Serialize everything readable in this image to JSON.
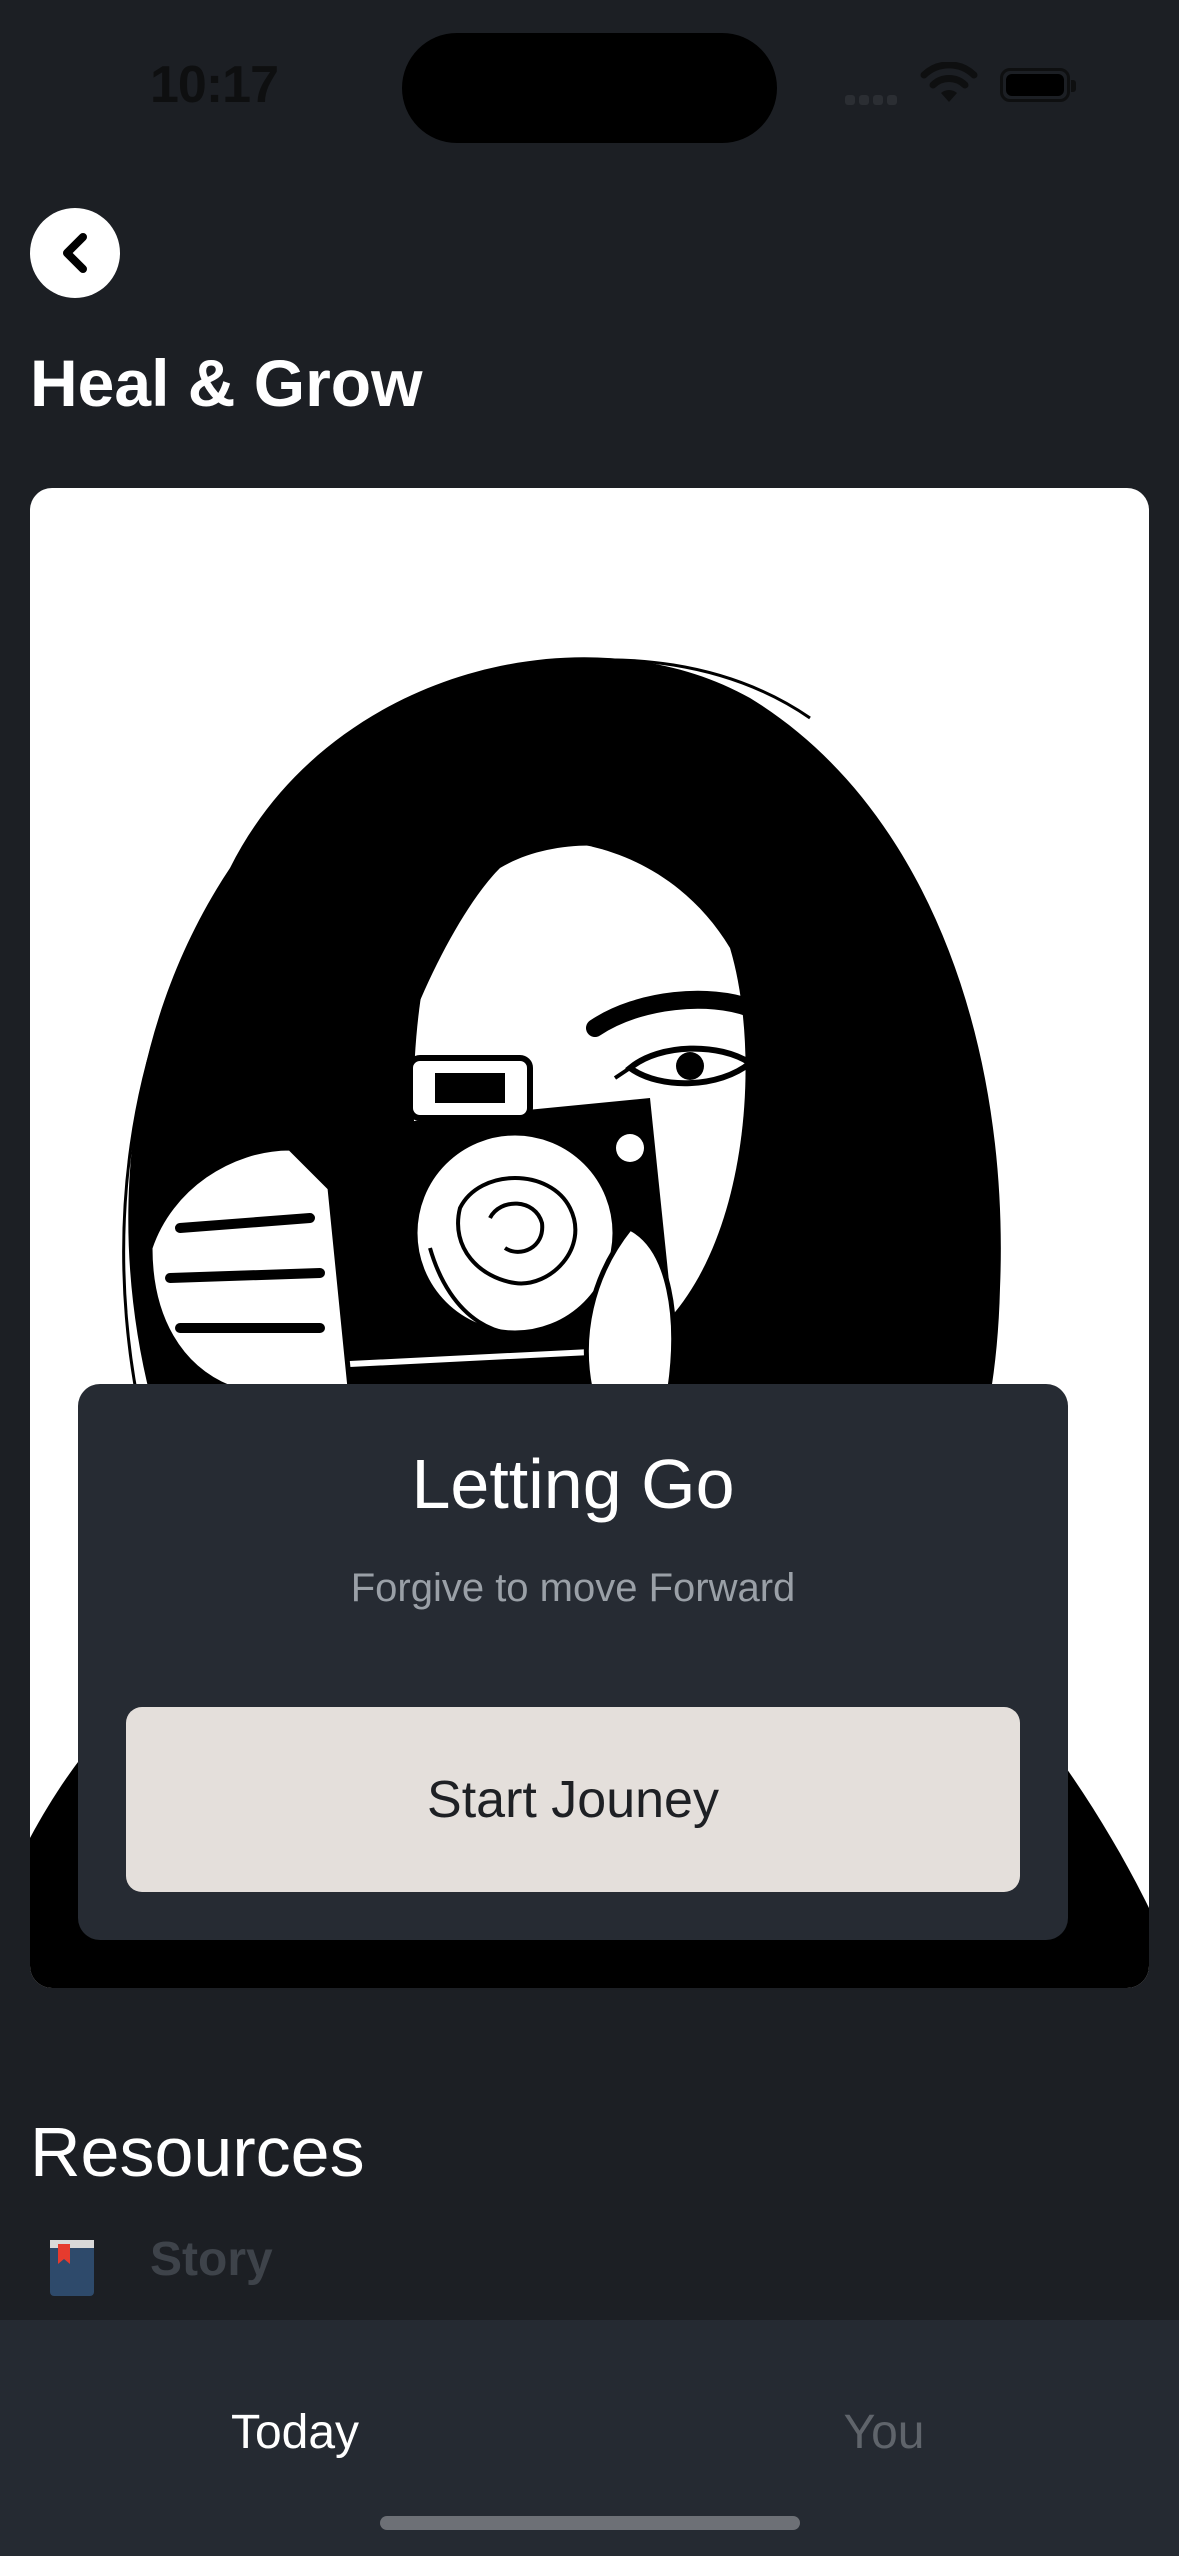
{
  "status_bar": {
    "time": "10:17"
  },
  "header": {
    "back_icon": "chevron-left-icon",
    "title": "Heal & Grow"
  },
  "hero": {
    "illustration": "woman-with-camera-and-rose-illustration",
    "card_title": "Letting Go",
    "card_subtitle": "Forgive to move Forward",
    "button_label": "Start Jouney"
  },
  "resources": {
    "title": "Resources",
    "items": [
      {
        "icon": "book-icon",
        "label": "Story"
      }
    ]
  },
  "tab_bar": {
    "tabs": [
      {
        "label": "Today",
        "selected": true
      },
      {
        "label": "You",
        "selected": false
      }
    ]
  }
}
